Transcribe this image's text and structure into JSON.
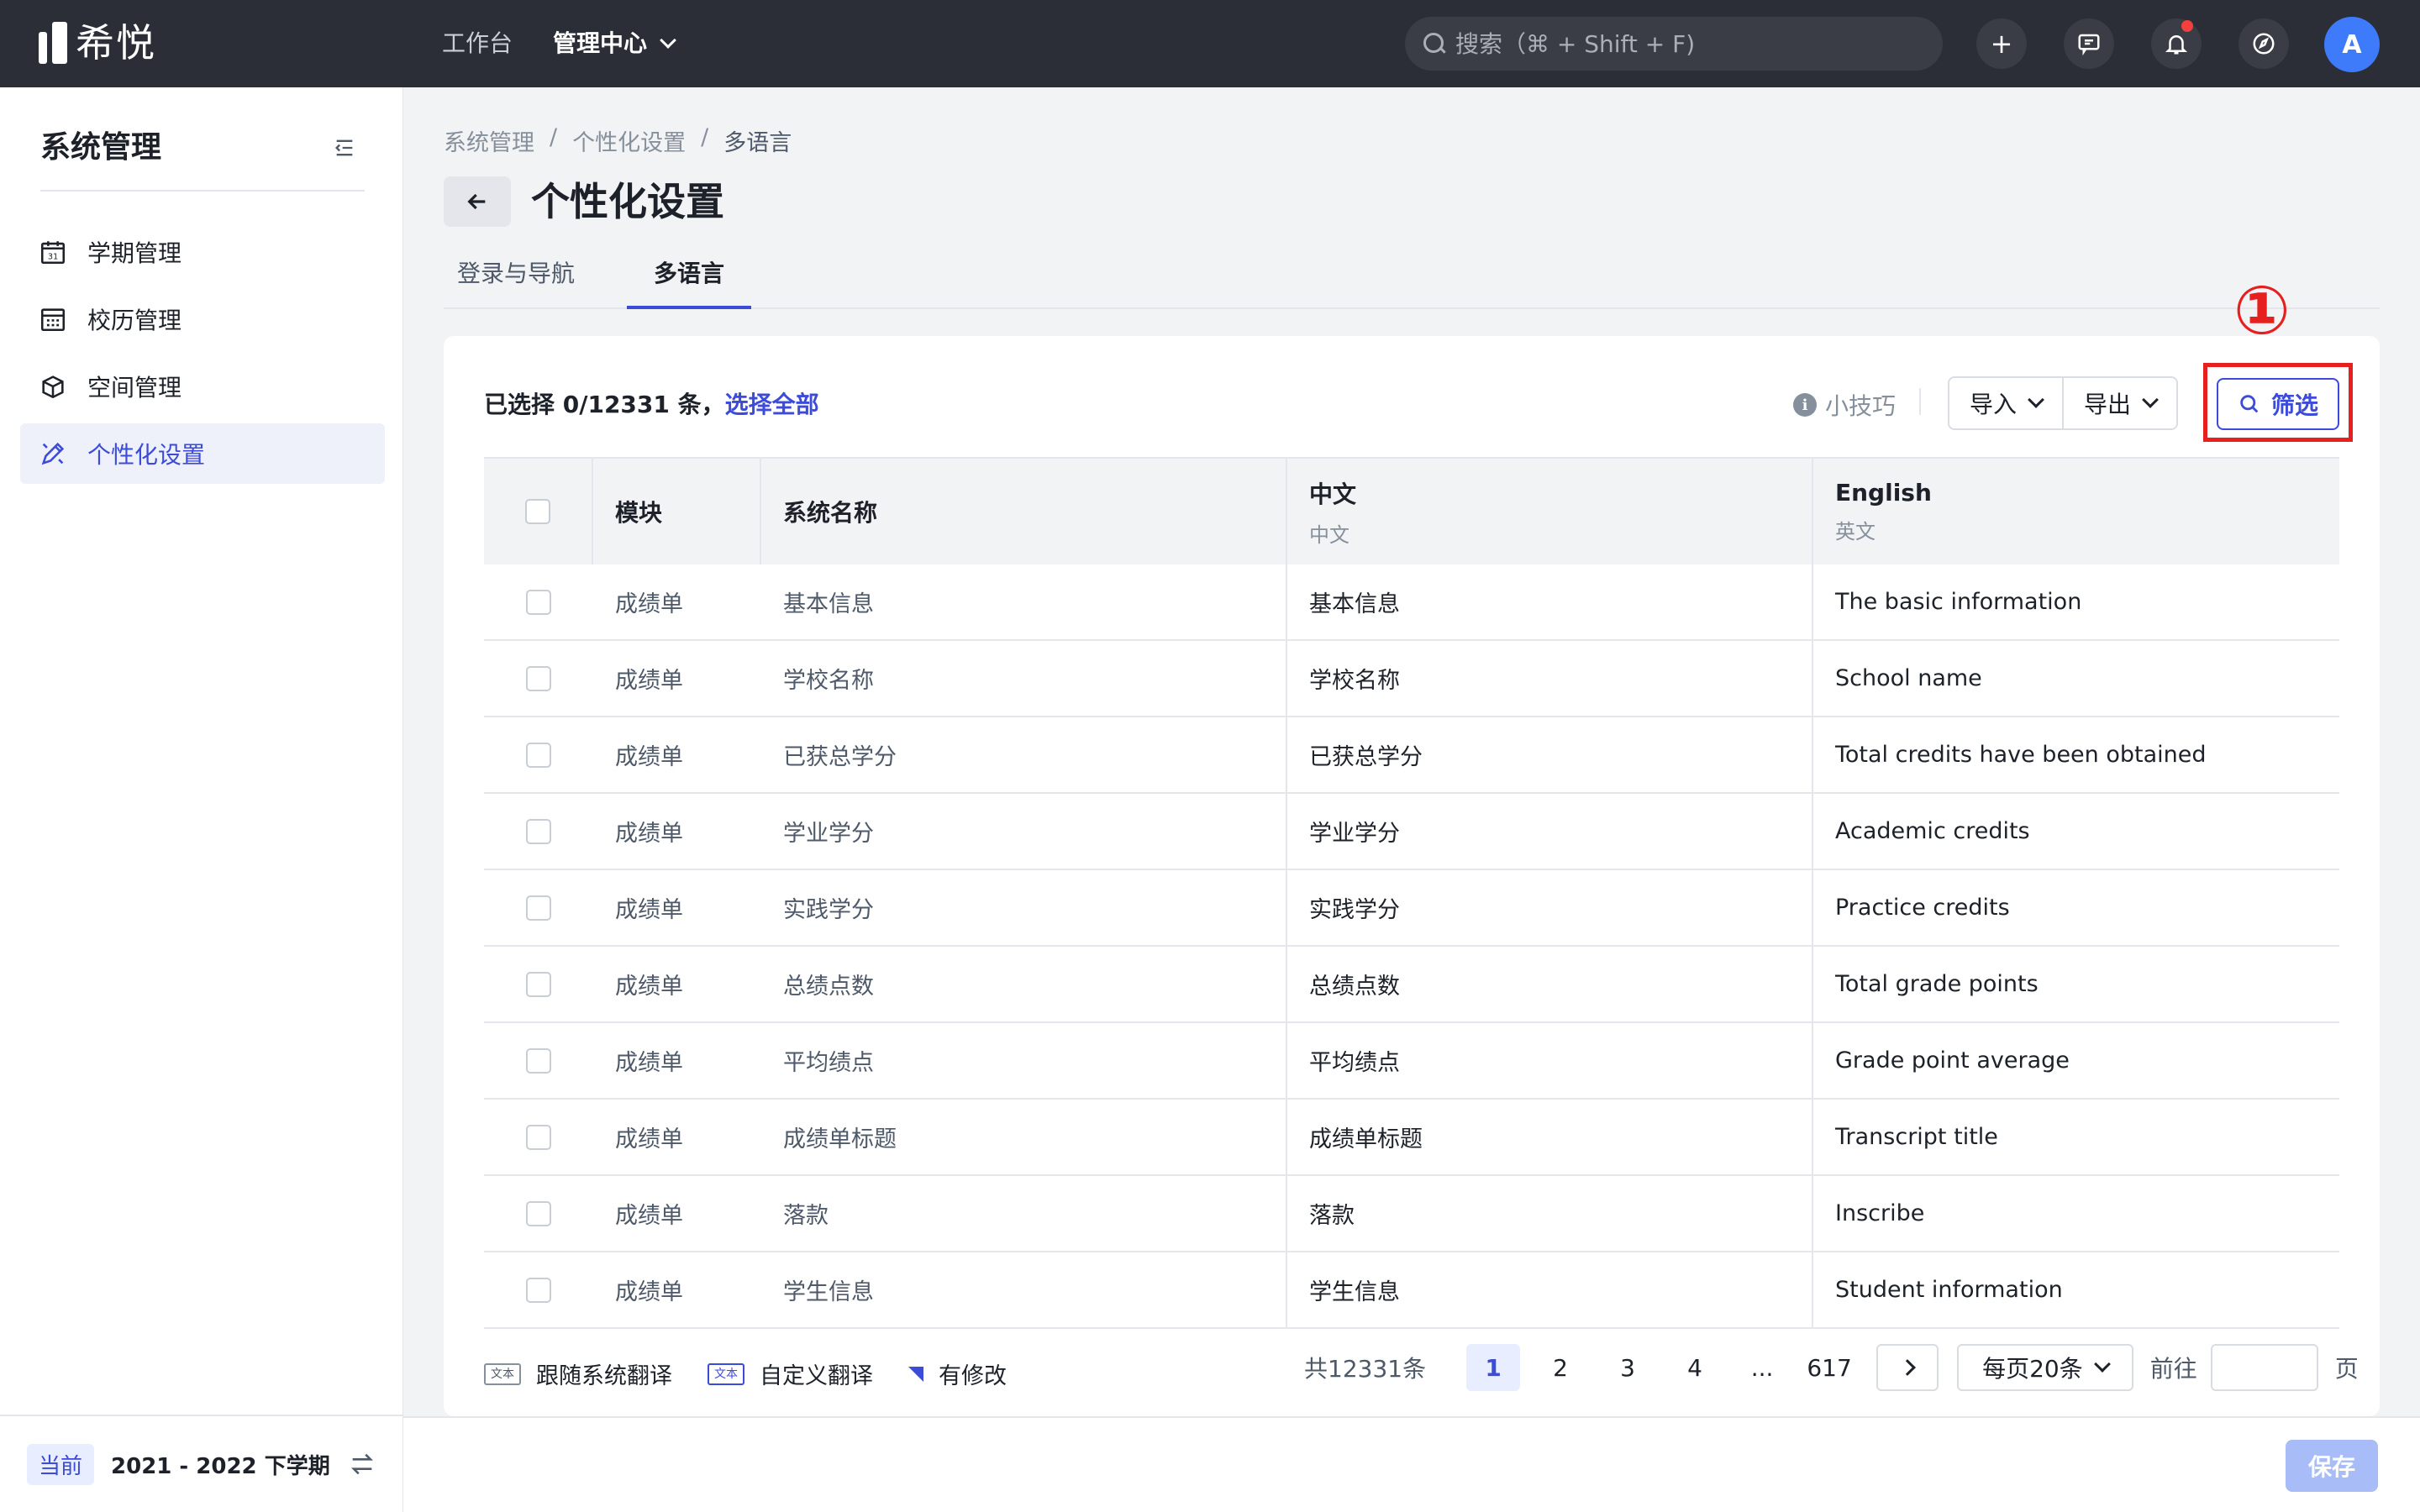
{
  "app": {
    "logo_text": "希悦"
  },
  "topnav": {
    "items": [
      {
        "label": "工作台"
      },
      {
        "label": "管理中心"
      }
    ]
  },
  "search": {
    "placeholder": "搜索（⌘ + Shift + F)"
  },
  "toolbar": {
    "add_label": "+"
  },
  "user": {
    "avatar_letter": "A"
  },
  "sidebar": {
    "title": "系统管理",
    "items": [
      {
        "label": "学期管理",
        "icon": "calendar-icon"
      },
      {
        "label": "校历管理",
        "icon": "calendar-grid-icon"
      },
      {
        "label": "空间管理",
        "icon": "cube-icon"
      },
      {
        "label": "个性化设置",
        "icon": "brush-icon",
        "active": true
      }
    ],
    "footer": {
      "tag": "当前",
      "term": "2021 - 2022 下学期"
    }
  },
  "breadcrumb": {
    "items": [
      "系统管理",
      "/",
      "个性化设置",
      "/",
      "多语言"
    ]
  },
  "page": {
    "title": "个性化设置"
  },
  "tabs": [
    {
      "label": "登录与导航"
    },
    {
      "label": "多语言",
      "active": true
    }
  ],
  "selection": {
    "text": "已选择 0/12331 条，",
    "select_all": "选择全部"
  },
  "actions": {
    "tips": "小技巧",
    "import": "导入",
    "export": "导出",
    "filter": "筛选",
    "annotation": "①"
  },
  "table": {
    "headers": {
      "module": "模块",
      "system_name": "系统名称",
      "zh": "中文",
      "zh_sub": "中文",
      "en": "English",
      "en_sub": "英文"
    },
    "rows": [
      {
        "module": "成绩单",
        "name": "基本信息",
        "zh": "基本信息",
        "en": "The basic information"
      },
      {
        "module": "成绩单",
        "name": "学校名称",
        "zh": "学校名称",
        "en": "School name"
      },
      {
        "module": "成绩单",
        "name": "已获总学分",
        "zh": "已获总学分",
        "en": "Total credits have been obtained"
      },
      {
        "module": "成绩单",
        "name": "学业学分",
        "zh": "学业学分",
        "en": "Academic credits"
      },
      {
        "module": "成绩单",
        "name": "实践学分",
        "zh": "实践学分",
        "en": "Practice credits"
      },
      {
        "module": "成绩单",
        "name": "总绩点数",
        "zh": "总绩点数",
        "en": "Total grade points"
      },
      {
        "module": "成绩单",
        "name": "平均绩点",
        "zh": "平均绩点",
        "en": "Grade point average"
      },
      {
        "module": "成绩单",
        "name": "成绩单标题",
        "zh": "成绩单标题",
        "en": "Transcript title"
      },
      {
        "module": "成绩单",
        "name": "落款",
        "zh": "落款",
        "en": "Inscribe"
      },
      {
        "module": "成绩单",
        "name": "学生信息",
        "zh": "学生信息",
        "en": "Student information"
      }
    ]
  },
  "legend": {
    "tag_text": "文本",
    "follow_system": "跟随系统翻译",
    "custom": "自定义翻译",
    "modified": "有修改"
  },
  "pagination": {
    "total": "共12331条",
    "pages": [
      "1",
      "2",
      "3",
      "4",
      "...",
      "617"
    ],
    "current": "1",
    "page_size": "每页20条",
    "goto_label": "前往",
    "goto_unit": "页"
  },
  "footer": {
    "save": "保存"
  },
  "colors": {
    "accent": "#3c4bd8",
    "topbar": "#2b2e36",
    "highlight": "#e61f1f"
  }
}
